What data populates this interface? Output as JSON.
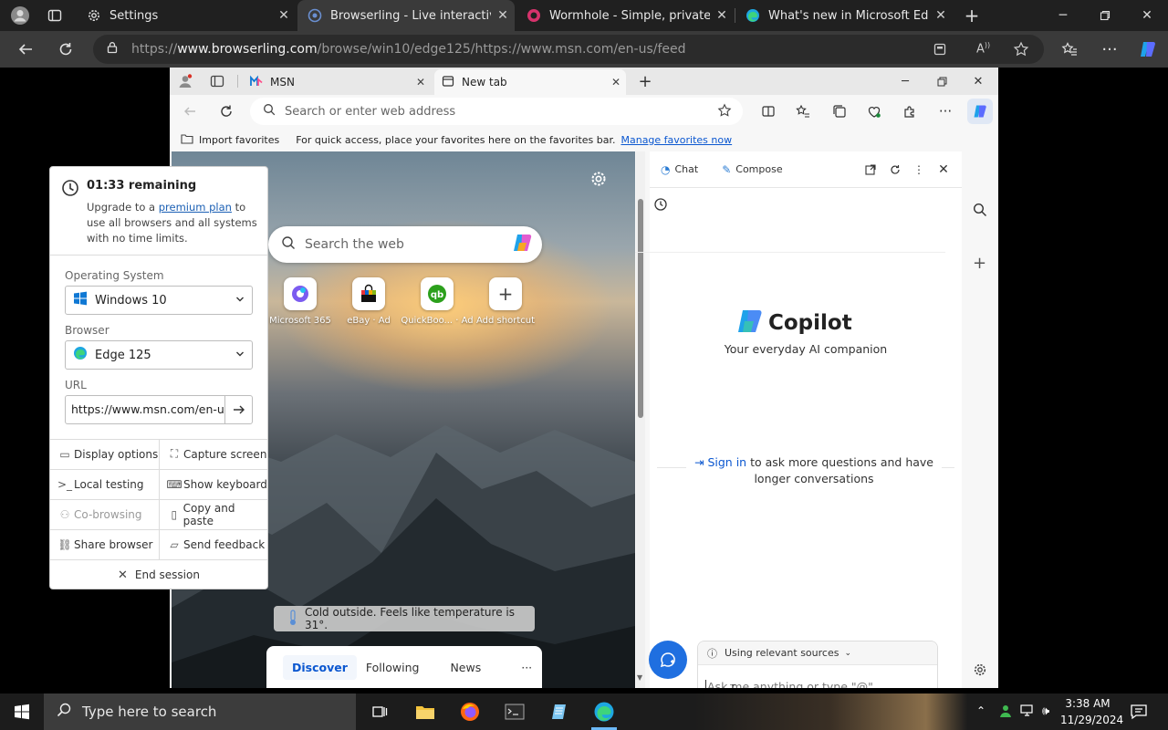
{
  "outer": {
    "tabs": [
      {
        "label": "Settings"
      },
      {
        "label": "Browserling - Live interactive cros"
      },
      {
        "label": "Wormhole - Simple, private file sh"
      },
      {
        "label": "What's new in Microsoft Edge"
      }
    ],
    "url_prefix": "https://",
    "url_host": "www.browserling.com",
    "url_rest": "/browse/win10/edge125/https://www.msn.com/en-us/feed"
  },
  "inner": {
    "tabs": [
      {
        "label": "MSN"
      },
      {
        "label": "New tab"
      }
    ],
    "address_placeholder": "Search or enter web address",
    "favbar": {
      "import": "Import favorites",
      "text": "For quick access, place your favorites here on the favorites bar.",
      "link": "Manage favorites now"
    },
    "ntp": {
      "search_placeholder": "Search the web",
      "tiles": [
        {
          "label": "Microsoft 365"
        },
        {
          "label": "eBay · Ad"
        },
        {
          "label": "QuickBoo... · Ad"
        },
        {
          "label": "Add shortcut"
        }
      ],
      "weather": "Cold outside. Feels like temperature is 31°.",
      "feed_tabs": [
        "Discover",
        "Following",
        "News"
      ],
      "feed_more": "···"
    },
    "copilot": {
      "tab_chat": "Chat",
      "tab_compose": "Compose",
      "title": "Copilot",
      "subtitle": "Your everyday AI companion",
      "sign_in": "Sign in",
      "sign_in_rest": "to ask more questions and have",
      "sign_in_line2": "longer conversations",
      "sources": "Using relevant sources",
      "input_placeholder": "Ask me anything or type \"@\""
    }
  },
  "session": {
    "timer": "01:33 remaining",
    "upgrade_pre": "Upgrade to a ",
    "upgrade_link": "premium plan",
    "upgrade_post": " to",
    "upgrade_line2": "use all browsers and all systems",
    "upgrade_line3": "with no time limits.",
    "os_label": "Operating System",
    "os_value": "Windows 10",
    "browser_label": "Browser",
    "browser_value": "Edge 125",
    "url_label": "URL",
    "url_value": "https://www.msn.com/en-us",
    "buttons": [
      {
        "label": "Display options",
        "icon": "monitor-icon"
      },
      {
        "label": "Capture screen",
        "icon": "capture-icon"
      },
      {
        "label": "Local testing",
        "icon": "terminal-icon"
      },
      {
        "label": "Show keyboard",
        "icon": "keyboard-icon"
      },
      {
        "label": "Co-browsing",
        "icon": "users-icon"
      },
      {
        "label": "Copy and paste",
        "icon": "clipboard-icon"
      },
      {
        "label": "Share browser",
        "icon": "link-icon"
      },
      {
        "label": "Send feedback",
        "icon": "feedback-icon"
      }
    ],
    "end": "End session"
  },
  "taskbar": {
    "search_placeholder": "Type here to search",
    "time": "3:38 AM",
    "date": "11/29/2024"
  },
  "colors": {
    "accent": "#0b57d0",
    "edge_blue": "#0f78d4",
    "copilot_blue": "#2b7cd3"
  }
}
